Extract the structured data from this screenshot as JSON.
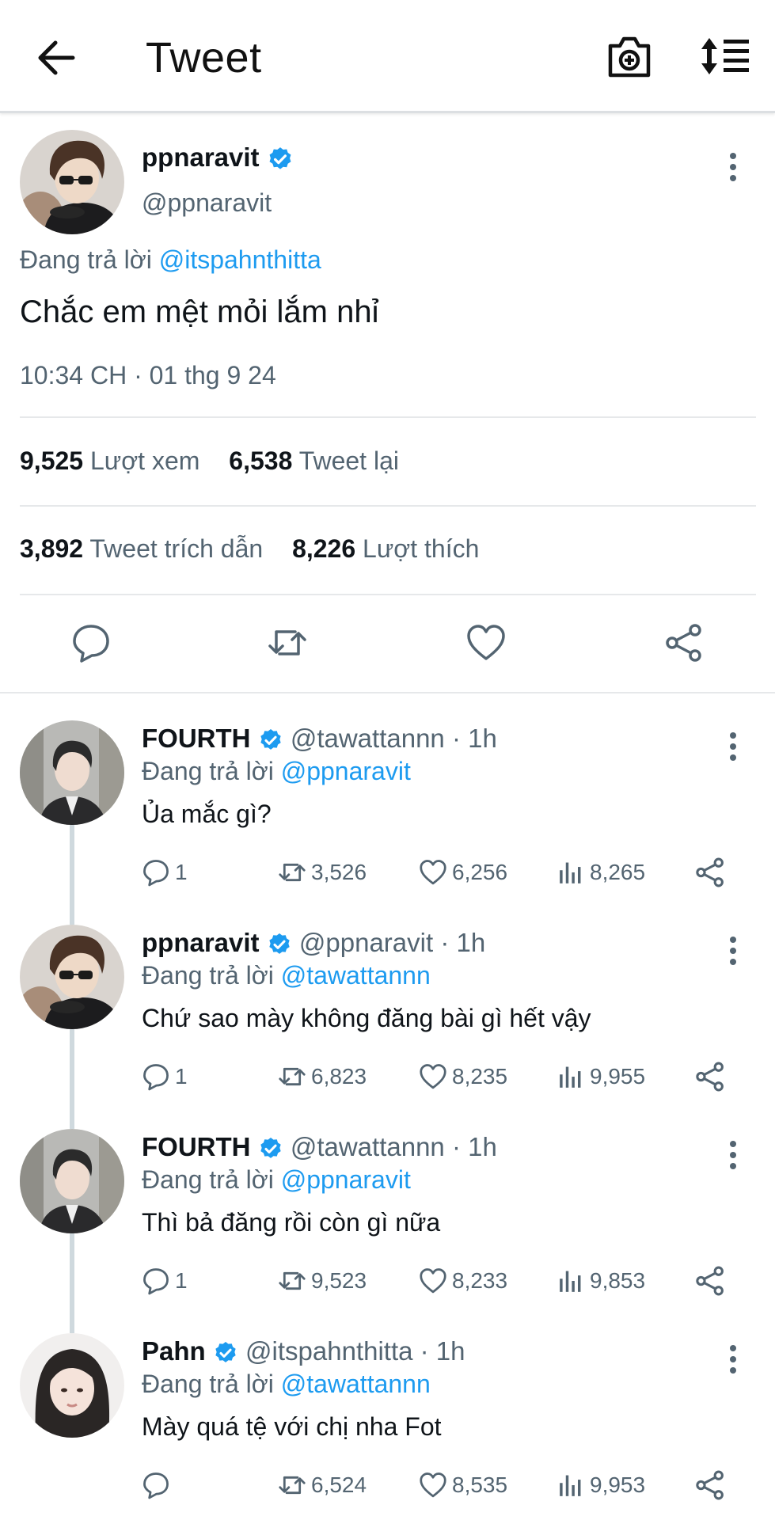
{
  "header": {
    "title": "Tweet"
  },
  "main_tweet": {
    "name": "ppnaravit",
    "handle": "@ppnaravit",
    "replying_prefix": "Đang trả lời",
    "replying_to": "@itspahnthitta",
    "text": "Chắc em mệt mỏi lắm nhỉ",
    "timestamp": "10:34 CH · 01 thg 9 24",
    "stats": {
      "views_count": "9,525",
      "views_label": "Lượt xem",
      "retweets_count": "6,538",
      "retweets_label": "Tweet lại",
      "quotes_count": "3,892",
      "quotes_label": "Tweet trích dẫn",
      "likes_count": "8,226",
      "likes_label": "Lượt thích"
    }
  },
  "replies": [
    {
      "name": "FOURTH",
      "handle": "@tawattannn · 1h",
      "replying_prefix": "Đang trả lời",
      "replying_to": "@ppnaravit",
      "text": "Ủa mắc gì?",
      "reply_count": "1",
      "retweet_count": "3,526",
      "like_count": "6,256",
      "view_count": "8,265"
    },
    {
      "name": "ppnaravit",
      "handle": "@ppnaravit · 1h",
      "replying_prefix": "Đang trả lời",
      "replying_to": "@tawattannn",
      "text": "Chứ sao mày không đăng bài gì hết vậy",
      "reply_count": "1",
      "retweet_count": "6,823",
      "like_count": "8,235",
      "view_count": "9,955"
    },
    {
      "name": "FOURTH",
      "handle": "@tawattannn · 1h",
      "replying_prefix": "Đang trả lời",
      "replying_to": "@ppnaravit",
      "text": "Thì bả đăng rồi còn gì nữa",
      "reply_count": "1",
      "retweet_count": "9,523",
      "like_count": "8,233",
      "view_count": "9,853"
    },
    {
      "name": "Pahn",
      "handle": "@itspahnthitta · 1h",
      "replying_prefix": "Đang trả lời",
      "replying_to": "@tawattannn",
      "text": "Mày quá tệ với chị nha Fot",
      "reply_count": "",
      "retweet_count": "6,524",
      "like_count": "8,535",
      "view_count": "9,953"
    }
  ],
  "colors": {
    "accent": "#1d9bf0",
    "secondary_text": "#536471",
    "primary_text": "#0f1419",
    "divider": "#e6e8ea"
  }
}
